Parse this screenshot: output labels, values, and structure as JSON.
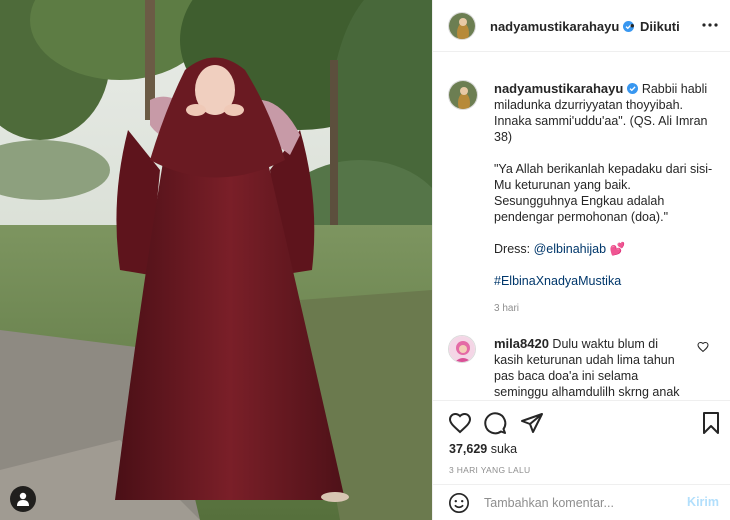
{
  "header": {
    "username": "nadyamustikarahayu",
    "separator": "•",
    "follow_state": "Diikuti"
  },
  "caption": {
    "username": "nadyamustikarahayu",
    "lead": "Rabbii habli miladunka dzurriyyatan thoyyibah. Innaka sammi'uddu'aa\". (QS. Ali Imran 38)",
    "translation": "\"Ya Allah berikanlah kepadaku dari sisi-Mu keturunan yang baik. Sesungguhnya Engkau adalah pendengar permohonan (doa).\"",
    "dress_prefix": "Dress: ",
    "dress_mention": "@elbinahijab",
    "dress_emoji": "💕",
    "hashtag": "#ElbinaXnadyaMustika",
    "time": "3 hari"
  },
  "comment": {
    "username": "mila8420",
    "text": "Dulu waktu blum di kasih keturunan udah lima tahun pas baca doa'a ini selama seminggu alhamdulilh skrng anak"
  },
  "actions": {
    "likes_count": "37,629",
    "likes_word": "suka",
    "timestamp": "3 HARI YANG LALU"
  },
  "add_comment": {
    "placeholder": "Tambahkan komentar...",
    "post_label": "Kirim"
  },
  "icons": {
    "verified": "verified-badge-icon",
    "more": "more-options-icon",
    "like": "heart-icon",
    "comment": "comment-bubble-icon",
    "share": "paper-plane-icon",
    "save": "bookmark-icon",
    "emoji": "emoji-icon",
    "tag": "user-tag-icon"
  },
  "colors": {
    "verified": "#3897f0",
    "link": "#00376b",
    "post_button": "#b2dffc",
    "dress": "#6a1a22"
  }
}
